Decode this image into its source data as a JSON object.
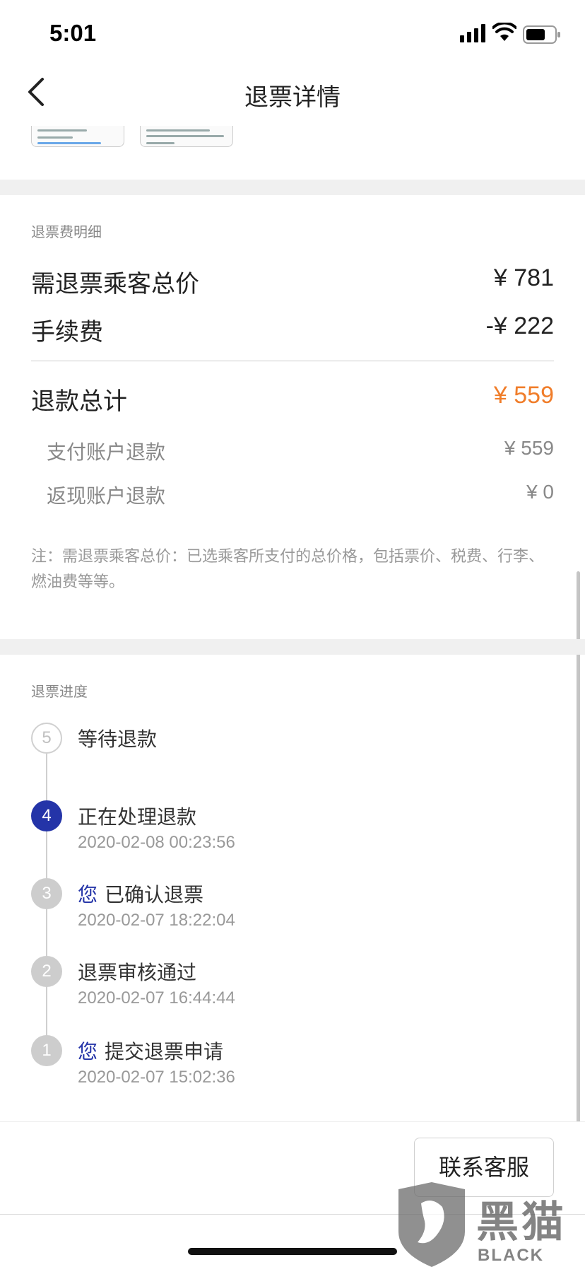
{
  "status_bar": {
    "time": "5:01"
  },
  "nav": {
    "title": "退票详情"
  },
  "fee_detail": {
    "section_title": "退票费明细",
    "total_label": "需退票乘客总价",
    "total_value": "¥ 781",
    "fee_label": "手续费",
    "fee_value": "-¥ 222",
    "refund_label": "退款总计",
    "refund_value": "¥ 559",
    "refund_color": "#f07d2a",
    "breakdown": [
      {
        "label": "支付账户退款",
        "value": "¥ 559"
      },
      {
        "label": "返现账户退款",
        "value": "¥ 0"
      }
    ],
    "note": "注：需退票乘客总价：已选乘客所支付的总价格，包括票价、税费、行李、燃油费等等。"
  },
  "progress": {
    "section_title": "退票进度",
    "steps": [
      {
        "number": "5",
        "prefix": "",
        "title": "等待退款",
        "time": "",
        "state": "pending"
      },
      {
        "number": "4",
        "prefix": "",
        "title": "正在处理退款",
        "time": "2020-02-08 00:23:56",
        "state": "active"
      },
      {
        "number": "3",
        "prefix": "您",
        "title": "已确认退票",
        "time": "2020-02-07 18:22:04",
        "state": "done"
      },
      {
        "number": "2",
        "prefix": "",
        "title": "退票审核通过",
        "time": "2020-02-07 16:44:44",
        "state": "done"
      },
      {
        "number": "1",
        "prefix": "您",
        "title": "提交退票申请",
        "time": "2020-02-07 15:02:36",
        "state": "done"
      }
    ],
    "active_color": "#2434a8"
  },
  "bottom": {
    "contact_label": "联系客服"
  },
  "watermark": {
    "text": "黑猫",
    "sub": "BLACK CAT"
  }
}
